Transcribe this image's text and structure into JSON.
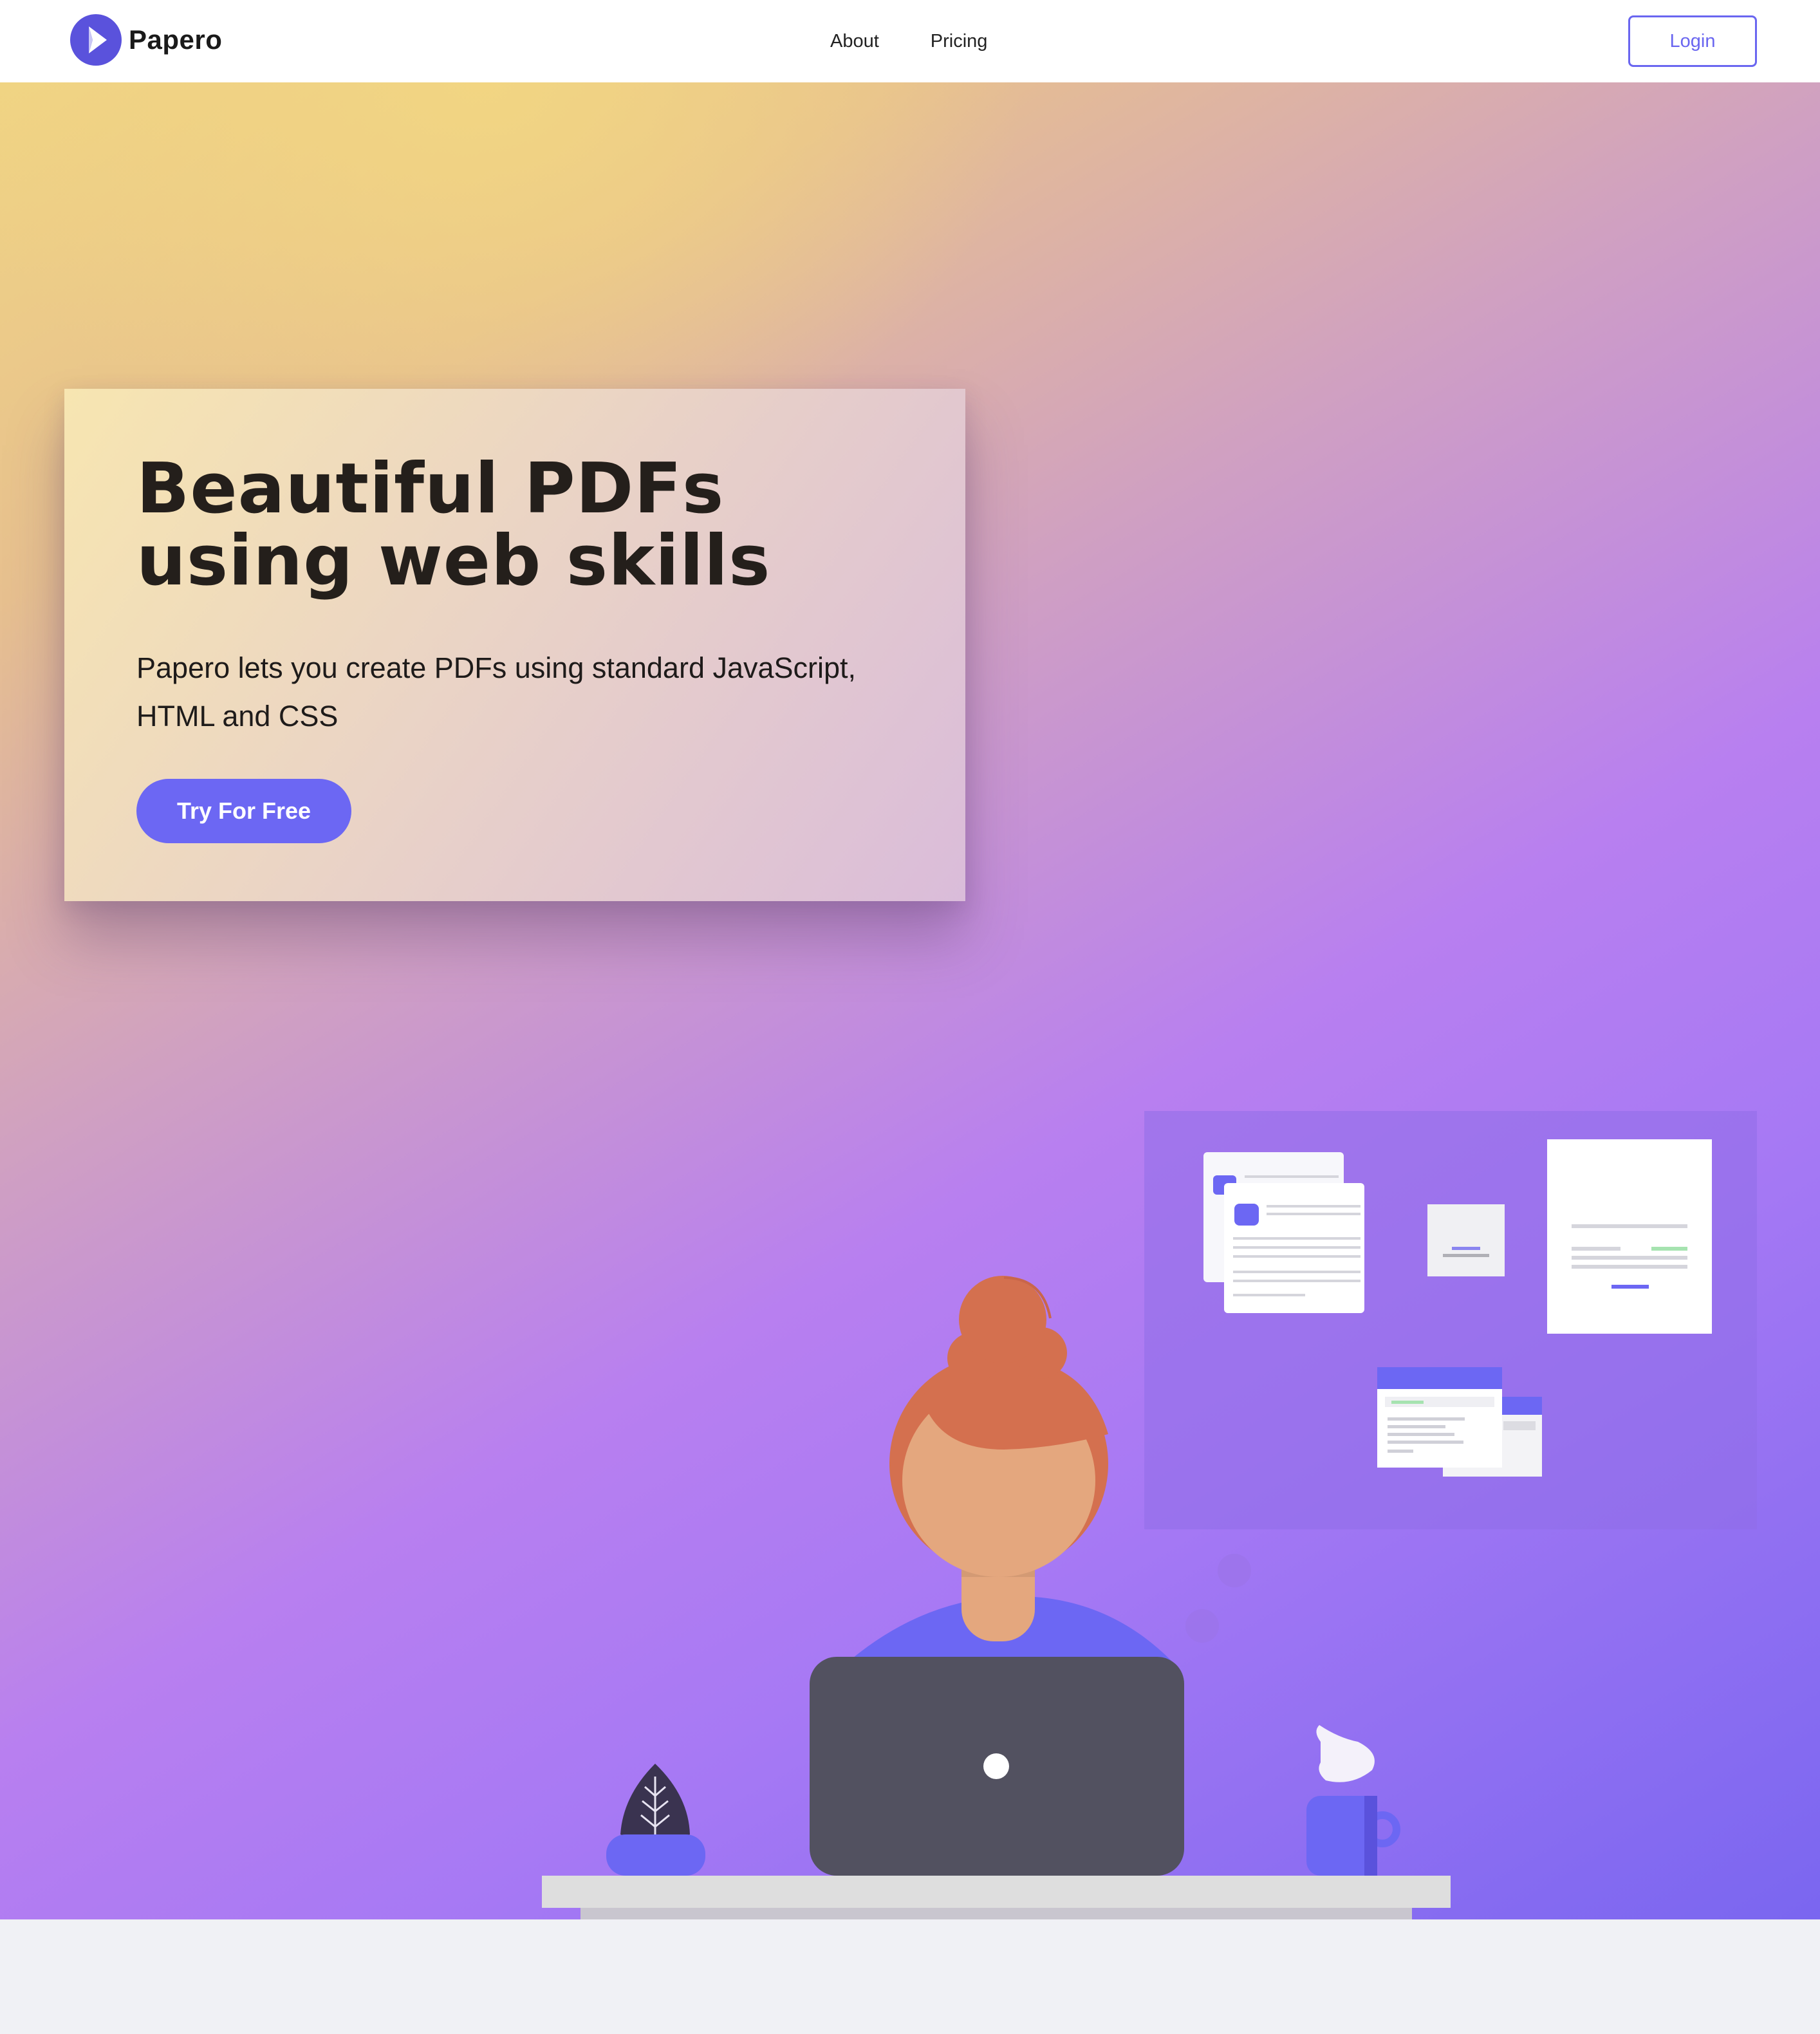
{
  "brand": {
    "name": "Papero",
    "accent": "#6a66f0",
    "logo_color": "#5a52dc"
  },
  "nav": {
    "links": [
      {
        "label": "About"
      },
      {
        "label": "Pricing"
      }
    ],
    "login_label": "Login"
  },
  "hero": {
    "title": "Beautiful PDFs using web skills",
    "subtitle": "Papero lets you create PDFs using standard JavaScript, HTML and CSS",
    "cta_label": "Try For Free"
  },
  "colors": {
    "gradient_start": "#f0d483",
    "gradient_mid": "#b87ff0",
    "gradient_end": "#7a66f0",
    "laptop": "#525160",
    "hair": "#d4704f",
    "skin": "#e4a77e",
    "shirt": "#6c67f3"
  }
}
